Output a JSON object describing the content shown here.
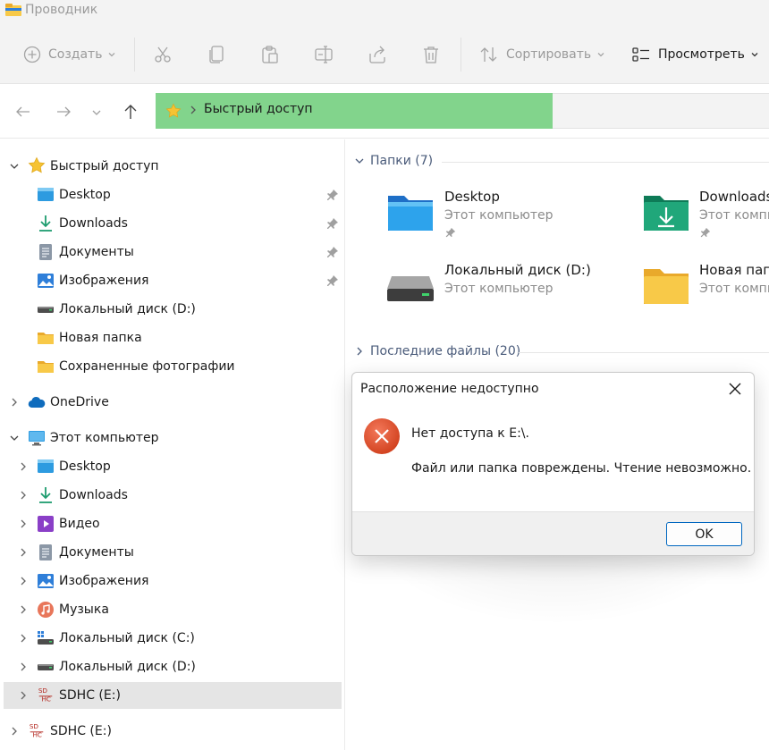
{
  "window": {
    "title": "Проводник"
  },
  "toolbar": {
    "create_label": "Создать",
    "sort_label": "Сортировать",
    "view_label": "Просмотреть"
  },
  "address": {
    "crumb": "Быстрый доступ"
  },
  "sidebar": {
    "quick_access": {
      "label": "Быстрый доступ",
      "items": [
        {
          "label": "Desktop",
          "icon": "desktop-icon",
          "pinned": true
        },
        {
          "label": "Downloads",
          "icon": "downloads-icon",
          "pinned": true
        },
        {
          "label": "Документы",
          "icon": "documents-icon",
          "pinned": true
        },
        {
          "label": "Изображения",
          "icon": "pictures-icon",
          "pinned": true
        },
        {
          "label": "Локальный диск (D:)",
          "icon": "drive-icon",
          "pinned": false
        },
        {
          "label": "Новая папка",
          "icon": "folder-icon",
          "pinned": false
        },
        {
          "label": "Сохраненные фотографии",
          "icon": "folder-icon",
          "pinned": false
        }
      ]
    },
    "onedrive": {
      "label": "OneDrive"
    },
    "this_pc": {
      "label": "Этот компьютер",
      "items": [
        {
          "label": "Desktop",
          "icon": "desktop-icon"
        },
        {
          "label": "Downloads",
          "icon": "downloads-icon"
        },
        {
          "label": "Видео",
          "icon": "video-icon"
        },
        {
          "label": "Документы",
          "icon": "documents-icon"
        },
        {
          "label": "Изображения",
          "icon": "pictures-icon"
        },
        {
          "label": "Музыка",
          "icon": "music-icon"
        },
        {
          "label": "Локальный диск (C:)",
          "icon": "system-drive-icon"
        },
        {
          "label": "Локальный диск (D:)",
          "icon": "drive-icon"
        },
        {
          "label": "SDHC (E:)",
          "icon": "sdhc-icon",
          "selected": true
        }
      ]
    },
    "sdhc_root": {
      "label": "SDHC (E:)"
    }
  },
  "main": {
    "folders_header": "Папки (7)",
    "recent_header": "Последние файлы (20)",
    "folders": [
      {
        "name": "Desktop",
        "sub": "Этот компьютер",
        "icon": "desktop-folder-icon",
        "pinned": true
      },
      {
        "name": "Downloads",
        "sub": "Этот компью",
        "icon": "downloads-folder-icon",
        "pinned": true
      },
      {
        "name": "Локальный диск (D:)",
        "sub": "Этот компьютер",
        "icon": "drive-icon",
        "pinned": false
      },
      {
        "name": "Новая папк",
        "sub": "Этот компь",
        "icon": "folder-icon",
        "pinned": false
      }
    ]
  },
  "dialog": {
    "title": "Расположение недоступно",
    "message_line1": "Нет доступа к E:\\.",
    "message_line2": "Файл или папка повреждены. Чтение невозможно.",
    "ok_label": "OK"
  },
  "colors": {
    "address_highlight": "#82d48c",
    "accent": "#0067c0",
    "error_red": "#e0502a",
    "folder_yellow": "#f8c948"
  }
}
